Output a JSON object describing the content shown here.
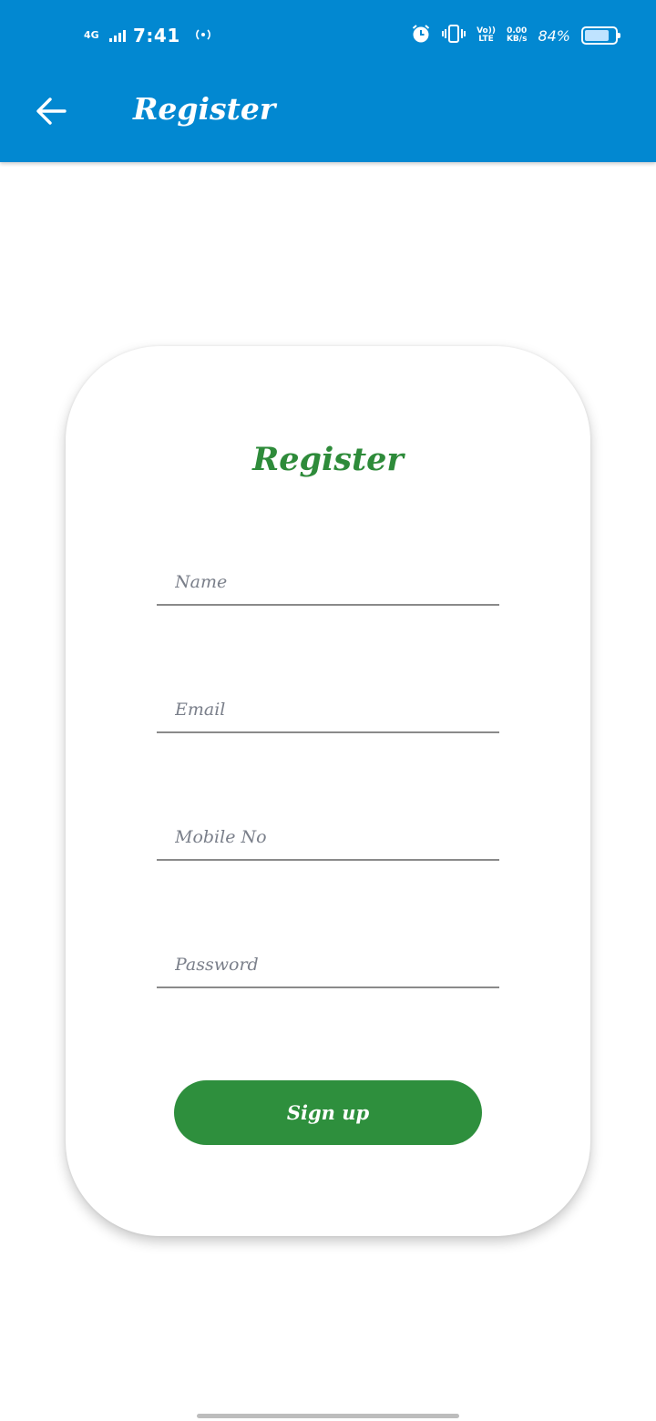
{
  "status_bar": {
    "network": "4G",
    "time": "7:41",
    "hotspot_icon": "hotspot-icon",
    "alarm_icon": "alarm-icon",
    "vibrate_icon": "vibrate-icon",
    "volte_top": "Vo))",
    "volte_bottom": "LTE",
    "speed_top": "0.00",
    "speed_bottom": "KB/s",
    "battery_text": "84%",
    "battery_level": 0.84
  },
  "appbar": {
    "back_icon": "arrow-back-icon",
    "title": "Register",
    "color": "#0288d1"
  },
  "form": {
    "title": "Register",
    "title_color": "#2e8b3a",
    "fields": [
      {
        "placeholder": "Name",
        "value": ""
      },
      {
        "placeholder": "Email",
        "value": ""
      },
      {
        "placeholder": "Mobile No",
        "value": ""
      },
      {
        "placeholder": "Password",
        "value": ""
      }
    ],
    "submit_label": "Sign up",
    "submit_color": "#2e8f3d"
  }
}
